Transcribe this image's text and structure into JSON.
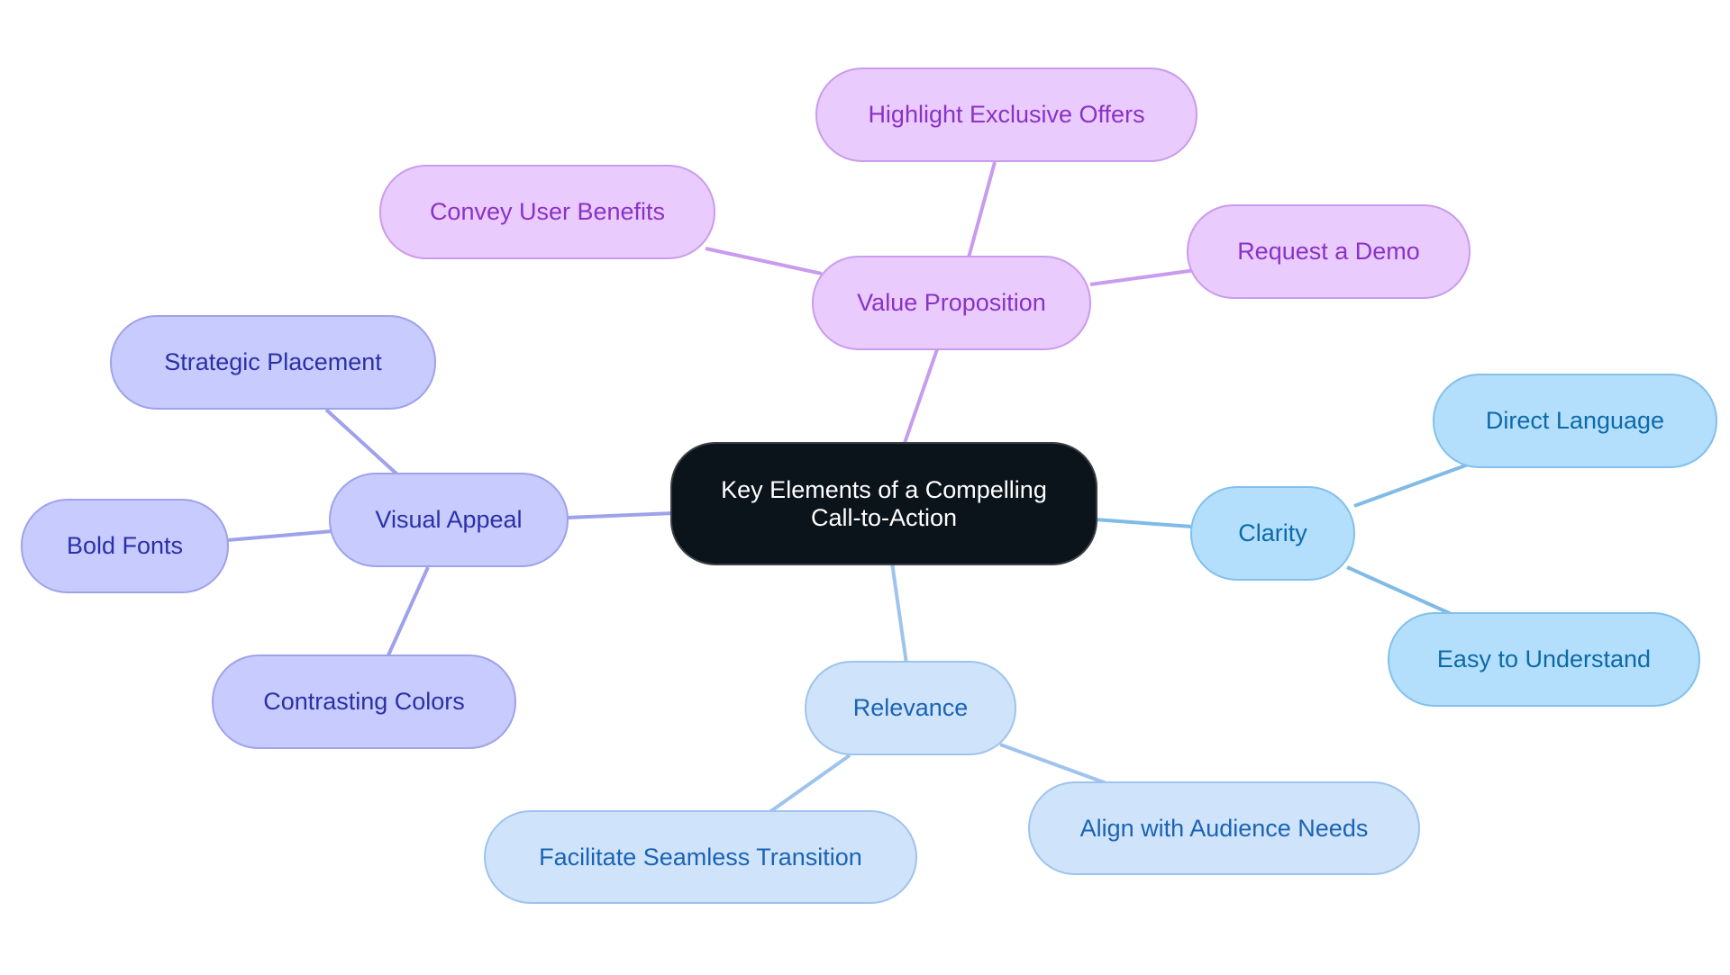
{
  "diagram": {
    "type": "mind-map",
    "root": {
      "id": "root",
      "label": "Key Elements of a Compelling\nCall-to-Action"
    },
    "branches": [
      {
        "id": "value",
        "label": "Value Proposition",
        "theme": "purple",
        "children": [
          {
            "id": "offers",
            "label": "Highlight Exclusive Offers"
          },
          {
            "id": "benefits",
            "label": "Convey User Benefits"
          },
          {
            "id": "demo",
            "label": "Request a Demo"
          }
        ]
      },
      {
        "id": "clarity",
        "label": "Clarity",
        "theme": "sky",
        "children": [
          {
            "id": "direct",
            "label": "Direct Language"
          },
          {
            "id": "easy",
            "label": "Easy to Understand"
          }
        ]
      },
      {
        "id": "relevance",
        "label": "Relevance",
        "theme": "lblue",
        "children": [
          {
            "id": "transition",
            "label": "Facilitate Seamless Transition"
          },
          {
            "id": "audience",
            "label": "Align with Audience Needs"
          }
        ]
      },
      {
        "id": "visual",
        "label": "Visual Appeal",
        "theme": "indigo",
        "children": [
          {
            "id": "placement",
            "label": "Strategic Placement"
          },
          {
            "id": "fonts",
            "label": "Bold Fonts"
          },
          {
            "id": "contrast",
            "label": "Contrasting Colors"
          }
        ]
      }
    ],
    "colors": {
      "root_fill": "#0b131b",
      "purple_fill": "#eacbfd",
      "purple_text": "#8a32c7",
      "purple_edge": "#c99bee",
      "sky_fill": "#b3dffc",
      "sky_text": "#0d6aa8",
      "sky_edge": "#7fbbe6",
      "lblue_fill": "#cfe4fb",
      "lblue_text": "#1a63b5",
      "lblue_edge": "#9ec3ee",
      "indigo_fill": "#c8cbfd",
      "indigo_text": "#2b30a8",
      "indigo_edge": "#9ea2ea"
    }
  }
}
